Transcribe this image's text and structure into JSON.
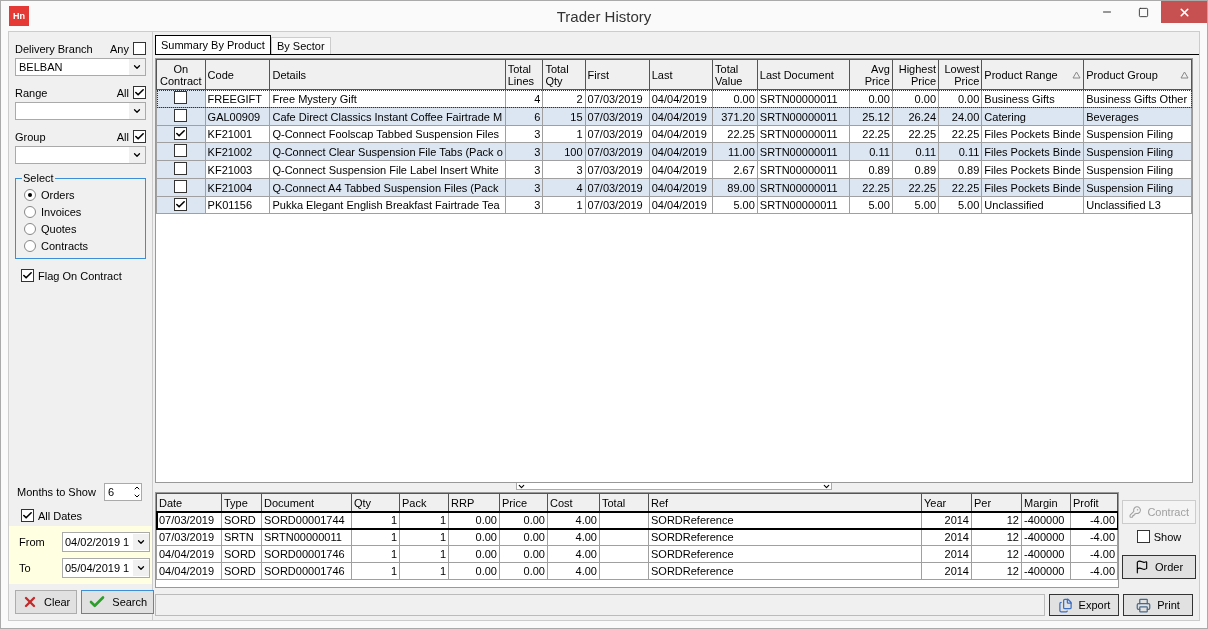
{
  "window": {
    "title": "Trader History",
    "logo": "Hn"
  },
  "filters": {
    "delivery_branch": {
      "label": "Delivery Branch",
      "any_label": "Any",
      "any_checked": false,
      "value": "BELBAN"
    },
    "range": {
      "label": "Range",
      "all_label": "All",
      "all_checked": true
    },
    "group": {
      "label": "Group",
      "all_label": "All",
      "all_checked": true
    },
    "select": {
      "title": "Select",
      "options": [
        {
          "label": "Orders",
          "selected": true
        },
        {
          "label": "Invoices",
          "selected": false
        },
        {
          "label": "Quotes",
          "selected": false
        },
        {
          "label": "Contracts",
          "selected": false
        }
      ]
    },
    "flag_on_contract": {
      "label": "Flag On Contract",
      "checked": true
    },
    "months": {
      "label": "Months to Show",
      "value": "6"
    },
    "all_dates": {
      "label": "All Dates",
      "checked": true
    },
    "from": {
      "label": "From",
      "value": "04/02/2019 1"
    },
    "to": {
      "label": "To",
      "value": "05/04/2019 1"
    },
    "buttons": [
      {
        "kind": "clear",
        "label": "Clear"
      },
      {
        "kind": "search",
        "label": "Search"
      }
    ]
  },
  "tabs": [
    {
      "label": "Summary By Product",
      "selected": true
    },
    {
      "label": "By Sector",
      "selected": false
    }
  ],
  "summary_table": {
    "check_column": "On Contract",
    "columns": [
      {
        "label": "Code",
        "sorted": false
      },
      {
        "label": "Details",
        "sorted": false
      },
      {
        "label": "Total Lines",
        "sorted": false
      },
      {
        "label": "Total Qty",
        "sorted": false
      },
      {
        "label": "First",
        "sorted": false
      },
      {
        "label": "Last",
        "sorted": false
      },
      {
        "label": "Total Value",
        "sorted": false
      },
      {
        "label": "Last Document",
        "sorted": false
      },
      {
        "label": "Avg Price",
        "sorted": false
      },
      {
        "label": "Highest Price",
        "sorted": false
      },
      {
        "label": "Lowest Price",
        "sorted": false
      },
      {
        "label": "Product Range",
        "sorted": true
      },
      {
        "label": "Product Group",
        "sorted": true
      }
    ],
    "rows": [
      {
        "on_contract": false,
        "focused": true,
        "cells": [
          "FREEGIFT",
          "Free Mystery Gift",
          "4",
          "2",
          "07/03/2019",
          "04/04/2019",
          "0.00",
          "SRTN00000011",
          "0.00",
          "0.00",
          "0.00",
          "Business Gifts",
          "Business Gifts Other"
        ]
      },
      {
        "on_contract": false,
        "focused": false,
        "cells": [
          "GAL00909",
          "Cafe Direct Classics Instant Coffee Fairtrade M",
          "6",
          "15",
          "07/03/2019",
          "04/04/2019",
          "371.20",
          "SRTN00000011",
          "25.12",
          "26.24",
          "24.00",
          "Catering",
          "Beverages"
        ]
      },
      {
        "on_contract": true,
        "focused": false,
        "cells": [
          "KF21001",
          "Q-Connect Foolscap Tabbed Suspension Files",
          "3",
          "1",
          "07/03/2019",
          "04/04/2019",
          "22.25",
          "SRTN00000011",
          "22.25",
          "22.25",
          "22.25",
          "Files  Pockets  Binde",
          "Suspension Filing"
        ]
      },
      {
        "on_contract": false,
        "focused": false,
        "cells": [
          "KF21002",
          "Q-Connect Clear Suspension File Tabs (Pack o",
          "3",
          "100",
          "07/03/2019",
          "04/04/2019",
          "11.00",
          "SRTN00000011",
          "0.11",
          "0.11",
          "0.11",
          "Files  Pockets  Binde",
          "Suspension Filing"
        ]
      },
      {
        "on_contract": false,
        "focused": false,
        "cells": [
          "KF21003",
          "Q-Connect Suspension File Label Insert White",
          "3",
          "3",
          "07/03/2019",
          "04/04/2019",
          "2.67",
          "SRTN00000011",
          "0.89",
          "0.89",
          "0.89",
          "Files  Pockets  Binde",
          "Suspension Filing"
        ]
      },
      {
        "on_contract": false,
        "focused": false,
        "cells": [
          "KF21004",
          "Q-Connect A4 Tabbed Suspension Files (Pack",
          "3",
          "4",
          "07/03/2019",
          "04/04/2019",
          "89.00",
          "SRTN00000011",
          "22.25",
          "22.25",
          "22.25",
          "Files  Pockets  Binde",
          "Suspension Filing"
        ]
      },
      {
        "on_contract": true,
        "focused": false,
        "cells": [
          "PK01156",
          "Pukka Elegant English Breakfast Fairtrade Tea",
          "3",
          "1",
          "07/03/2019",
          "04/04/2019",
          "5.00",
          "SRTN00000011",
          "5.00",
          "5.00",
          "5.00",
          "Unclassified",
          "Unclassified L3"
        ]
      }
    ]
  },
  "detail_table": {
    "columns": [
      "Date",
      "Type",
      "Document",
      "Qty",
      "Pack",
      "RRP",
      "Price",
      "Cost",
      "Total",
      "Ref",
      "Year",
      "Per",
      "Margin",
      "Profit"
    ],
    "rows": [
      {
        "current": true,
        "cells": [
          "07/03/2019",
          "SORD",
          "SORD00001744",
          "1",
          "1",
          "0.00",
          "0.00",
          "4.00",
          "",
          "SORDReference",
          "2014",
          "12",
          "-400000",
          "-4.00"
        ]
      },
      {
        "current": false,
        "cells": [
          "07/03/2019",
          "SRTN",
          "SRTN00000011",
          "1",
          "1",
          "0.00",
          "0.00",
          "4.00",
          "",
          "SORDReference",
          "2014",
          "12",
          "-400000",
          "-4.00"
        ]
      },
      {
        "current": false,
        "cells": [
          "04/04/2019",
          "SORD",
          "SORD00001746",
          "1",
          "1",
          "0.00",
          "0.00",
          "4.00",
          "",
          "SORDReference",
          "2014",
          "12",
          "-400000",
          "-4.00"
        ]
      },
      {
        "current": false,
        "cells": [
          "04/04/2019",
          "SORD",
          "SORD00001746",
          "1",
          "1",
          "0.00",
          "0.00",
          "4.00",
          "",
          "SORDReference",
          "2014",
          "12",
          "-400000",
          "-4.00"
        ]
      }
    ]
  },
  "side_actions": {
    "contract": {
      "label": "Contract",
      "disabled": true
    },
    "show": {
      "label": "Show",
      "checked": false
    },
    "order": {
      "label": "Order"
    }
  },
  "footer_buttons": [
    {
      "kind": "export",
      "label": "Export"
    },
    {
      "kind": "print",
      "label": "Print"
    }
  ]
}
